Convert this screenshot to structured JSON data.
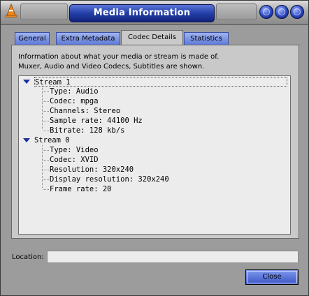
{
  "window": {
    "title": "Media Information"
  },
  "tabs": [
    {
      "label": "General"
    },
    {
      "label": "Extra Metadata"
    },
    {
      "label": "Codec Details"
    },
    {
      "label": "Statistics"
    }
  ],
  "active_tab": "Codec Details",
  "info_text": {
    "line1": "Information about what your media or stream is made of.",
    "line2": "Muxer, Audio and Video Codecs, Subtitles are shown."
  },
  "streams": [
    {
      "label": "Stream 1",
      "items": [
        "Type: Audio",
        "Codec: mpga",
        "Channels: Stereo",
        "Sample rate: 44100 Hz",
        "Bitrate: 128 kb/s"
      ]
    },
    {
      "label": "Stream 0",
      "items": [
        "Type: Video",
        "Codec: XVID",
        "Resolution: 320x240",
        "Display resolution: 320x240",
        "Frame rate: 20"
      ]
    }
  ],
  "location": {
    "label": "Location:",
    "value": ""
  },
  "buttons": {
    "close": "Close"
  },
  "colors": {
    "accent": "#2a48c0",
    "panel": "#c9c9c9",
    "tree_bg": "#ececec"
  }
}
